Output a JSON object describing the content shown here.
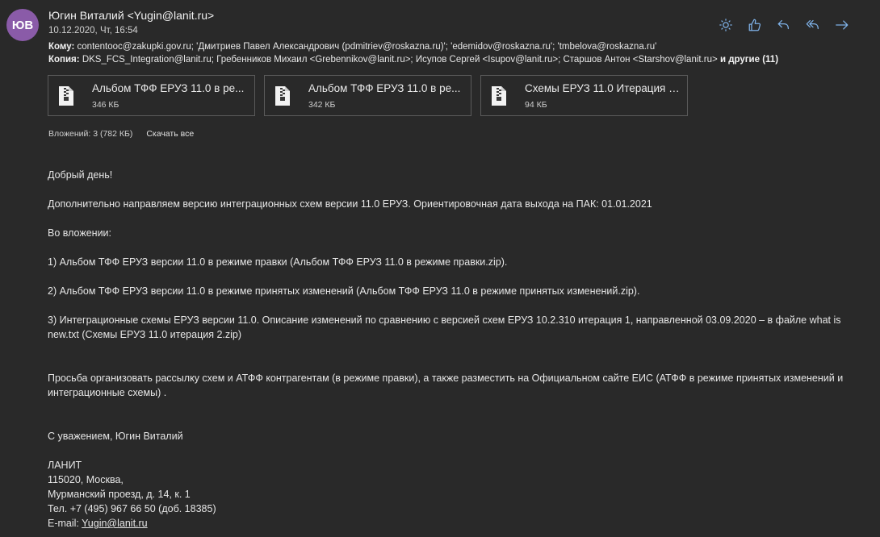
{
  "sender": {
    "initials": "ЮВ",
    "from": "Югин Виталий <Yugin@lanit.ru>",
    "date": "10.12.2020, Чт, 16:54",
    "avatar_color": "#8a5ba8"
  },
  "recipients": {
    "to_label": "Кому:",
    "to": "contentooc@zakupki.gov.ru; 'Дмитриев Павел Александрович (pdmitriev@roskazna.ru)'; 'edemidov@roskazna.ru'; 'tmbelova@roskazna.ru'",
    "cc_label": "Копия:",
    "cc": "DKS_FCS_Integration@lanit.ru; Гребенников Михаил <Grebennikov@lanit.ru>; Исупов Сергей <Isupov@lanit.ru>; Старшов Антон <Starshov@lanit.ru>",
    "others": "и другие (11)"
  },
  "toolbar": {
    "icons": [
      "sun-icon",
      "like-icon",
      "reply-icon",
      "reply-all-icon",
      "forward-icon"
    ]
  },
  "attachments": {
    "items": [
      {
        "name": "Альбом ТФФ ЕРУЗ 11.0 в ре...",
        "size": "346 КБ"
      },
      {
        "name": "Альбом ТФФ ЕРУЗ 11.0 в ре...",
        "size": "342 КБ"
      },
      {
        "name": "Схемы ЕРУЗ 11.0 Итерация 2...",
        "size": "94 КБ"
      }
    ],
    "summary": "Вложений: 3 (782 КБ)",
    "download_all": "Скачать все"
  },
  "message": {
    "greeting": "Добрый день!",
    "p1": "Дополнительно направляем версию интеграционных схем версии 11.0  ЕРУЗ. Ориентировочная дата выхода на ПАК: 01.01.2021",
    "p2": "Во вложении:",
    "item1": "1) Альбом ТФФ ЕРУЗ версии 11.0 в режиме правки (Альбом ТФФ ЕРУЗ 11.0 в режиме правки.zip).",
    "item2": "2)  Альбом ТФФ ЕРУЗ версии 11.0  в режиме принятых изменений (Альбом ТФФ ЕРУЗ 11.0 в режиме принятых изменений.zip).",
    "item3": "3)  Интеграционные схемы ЕРУЗ версии 11.0. Описание изменений по сравнению с версией схем ЕРУЗ 10.2.310 итерация 1, направленной 03.09.2020 – в файле what is new.txt (Схемы ЕРУЗ 11.0 итерация 2.zip)",
    "request": "Просьба организовать рассылку схем и АТФФ контрагентам (в режиме правки), а также разместить на Официальном сайте ЕИС (АТФФ в режиме принятых изменений и интеграционные схемы) .",
    "regards": "С уважением, Югин Виталий",
    "sig_company": "ЛАНИТ",
    "sig_city": "115020, Москва,",
    "sig_address": "Мурманский проезд, д. 14, к. 1",
    "sig_phone": "Тел.  +7 (495) 967 66 50 (доб.  18385)",
    "sig_email_label": "E-mail: ",
    "sig_email": "Yugin@lanit.ru"
  }
}
